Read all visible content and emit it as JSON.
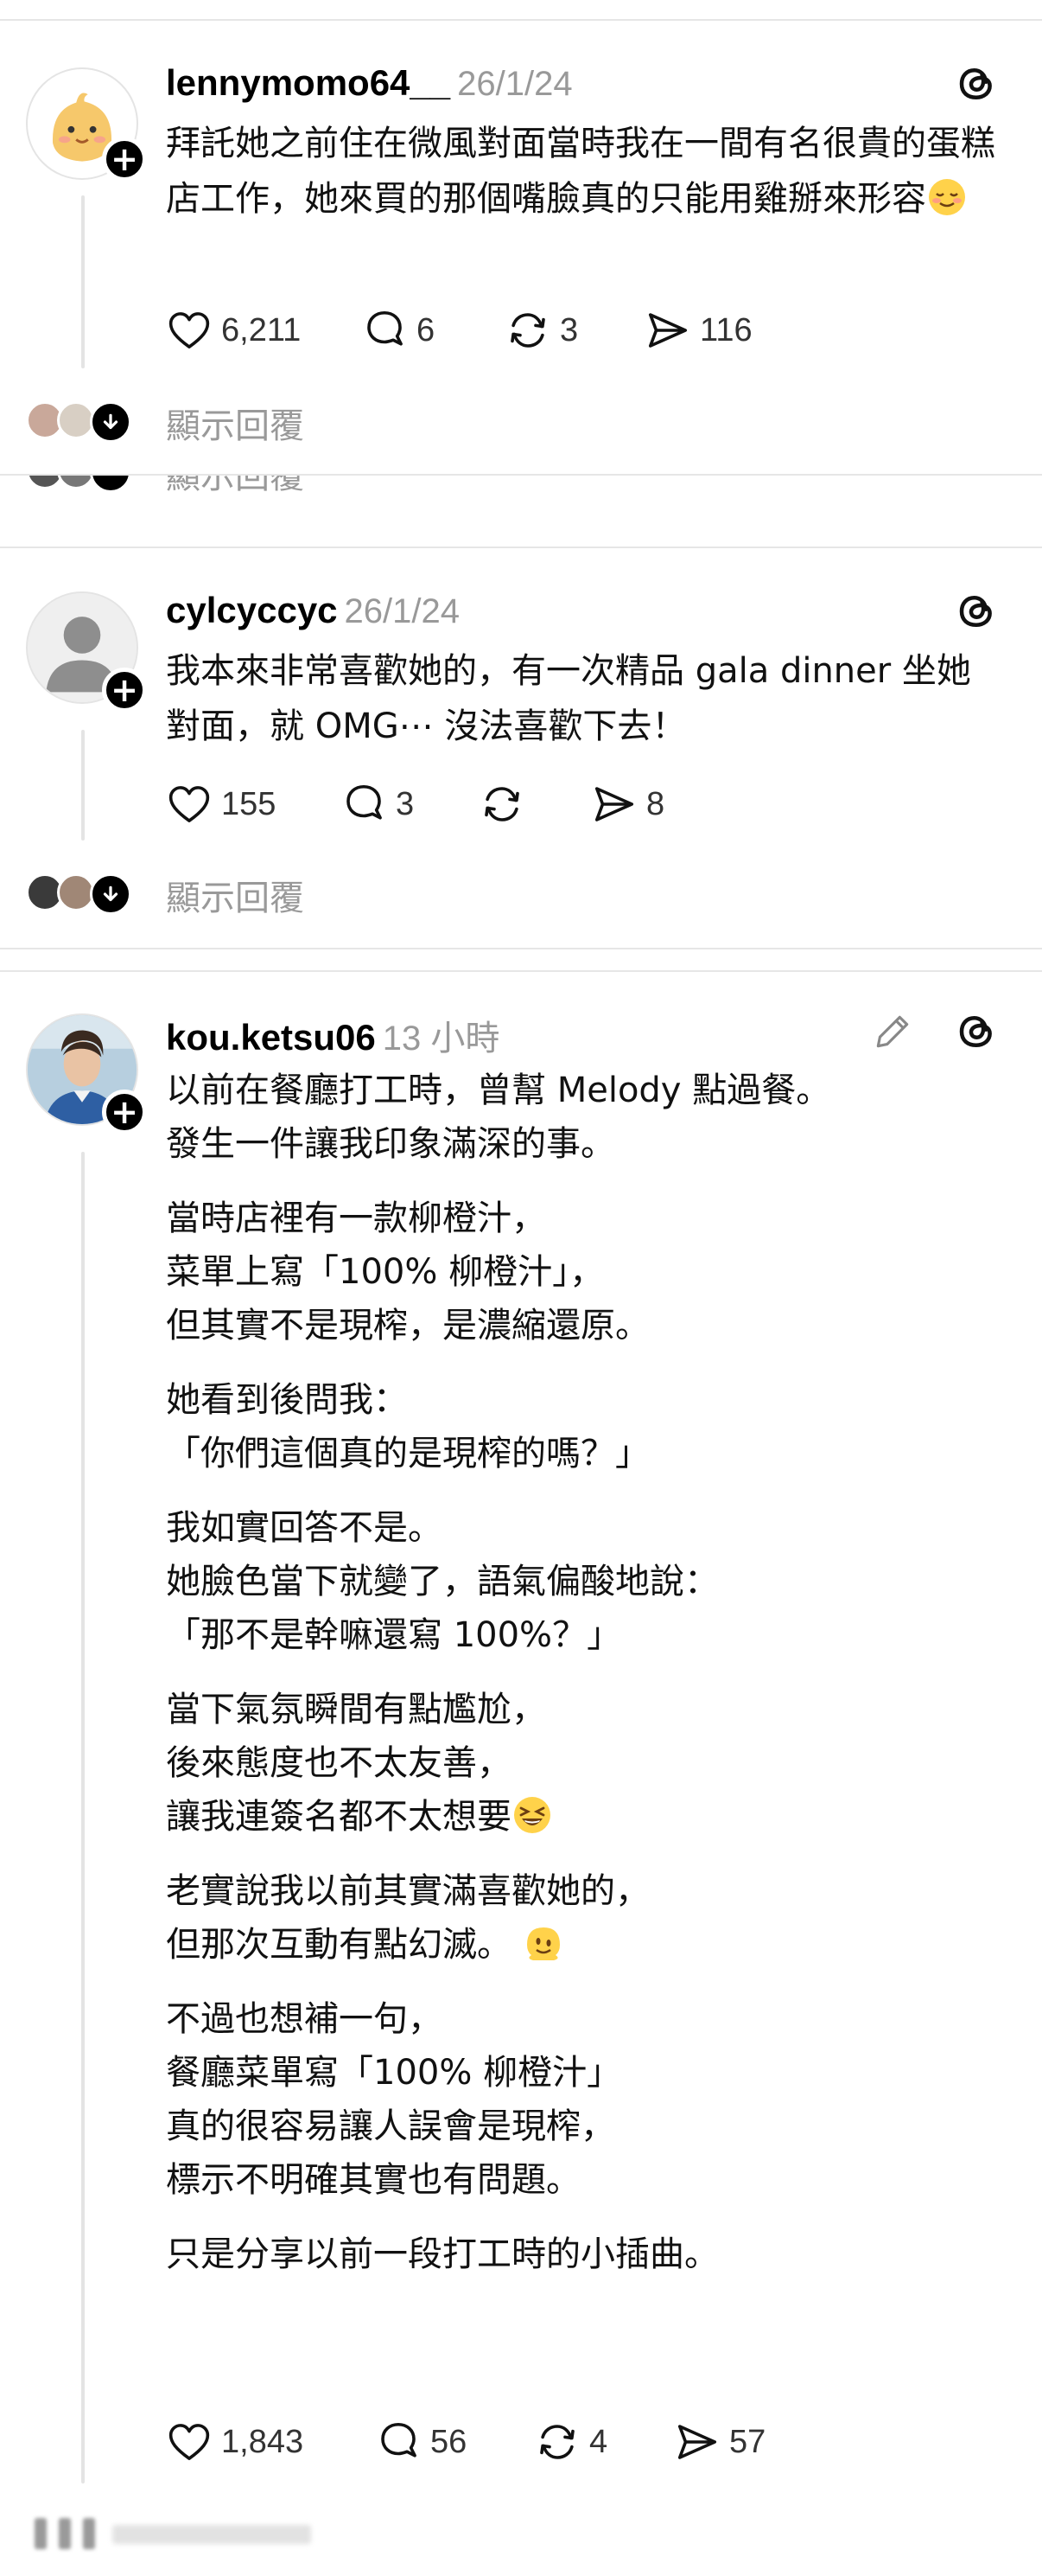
{
  "posts": [
    {
      "username": "lennymomo64__",
      "time": "26/1/24",
      "body": "拜託她之前住在微風對面當時我在一間有名很貴的蛋糕店工作，她來買的那個嘴臉真的只能用雞掰來形容",
      "body_emoji": "relieved-face-emoji",
      "likes": "6,211",
      "comments": "6",
      "reposts": "3",
      "shares": "116",
      "show_replies": "顯示回覆"
    },
    {
      "username": "cylcyccyc",
      "time": "26/1/24",
      "body": "我本來非常喜歡她的，有一次精品 gala dinner 坐她對面，就 OMG⋯ 沒法喜歡下去！",
      "likes": "155",
      "comments": "3",
      "reposts": "",
      "shares": "8",
      "show_replies": "顯示回覆"
    },
    {
      "username": "kou.ketsu06",
      "time": "13 小時",
      "paragraphs": [
        "以前在餐廳打工時，曾幫 Melody 點過餐。\n發生一件讓我印象滿深的事。",
        "當時店裡有一款柳橙汁，\n菜單上寫「100% 柳橙汁」，\n但其實不是現榨，是濃縮還原。",
        "她看到後問我：\n「你們這個真的是現榨的嗎？」",
        "我如實回答不是。\n她臉色當下就變了，語氣偏酸地說：\n「那不是幹嘛還寫 100%？」",
        "當下氣氛瞬間有點尷尬，\n後來態度也不太友善，\n讓我連簽名都不太想要",
        "老實說我以前其實滿喜歡她的，\n但那次互動有點幻滅。",
        "不過也想補一句，\n餐廳菜單寫「100% 柳橙汁」\n真的很容易讓人誤會是現榨，\n標示不明確其實也有問題。",
        "只是分享以前一段打工時的小插曲。"
      ],
      "emoji_p5": "grinning-squinting-emoji",
      "emoji_p6": "melting-face-emoji",
      "likes": "1,843",
      "comments": "56",
      "reposts": "4",
      "shares": "57"
    }
  ],
  "hidden_reply_label": "顯示回覆",
  "icons": [
    "threads-icon",
    "heart-icon",
    "comment-icon",
    "repost-icon",
    "share-icon",
    "pencil-icon",
    "plus-icon",
    "arrow-down-icon"
  ]
}
